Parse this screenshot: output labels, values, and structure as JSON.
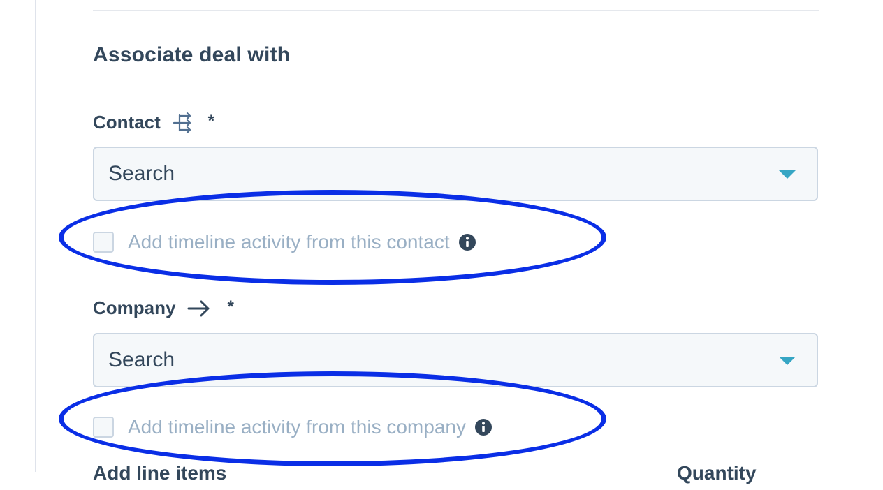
{
  "section": {
    "heading": "Associate deal with"
  },
  "contact": {
    "label": "Contact",
    "required_mark": "*",
    "label_icon": "associate-tree-icon",
    "select_placeholder": "Search",
    "checkbox_label": "Add timeline activity from this contact",
    "checked": false
  },
  "company": {
    "label": "Company",
    "required_mark": "*",
    "label_icon": "arrow-right-icon",
    "select_placeholder": "Search",
    "checkbox_label": "Add timeline activity from this company",
    "checked": false
  },
  "cutoff": {
    "left_label": "Add line items",
    "right_label": "Quantity"
  },
  "colors": {
    "heading": "#33475b",
    "muted_text": "#99afc4",
    "caret": "#36a6c4",
    "annotation": "#0a2ee6"
  }
}
